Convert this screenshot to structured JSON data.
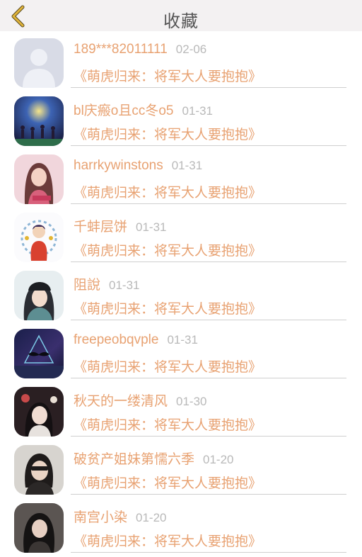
{
  "header": {
    "title": "收藏",
    "back_icon": "chevron-left-icon",
    "accent_color": "#e0b43a"
  },
  "colors": {
    "name": "#e8a272",
    "date": "#b9b9b9",
    "book": "#e8a272"
  },
  "favorites": [
    {
      "name": "189***82011111",
      "date": "02-06",
      "book": "《萌虎归来：将军大人要抱抱》",
      "avatar": "default-avatar-icon"
    },
    {
      "name": "bl庆瘢o且cc冬o5",
      "date": "01-31",
      "book": "《萌虎归来：将军大人要抱抱》",
      "avatar": "user-avatar"
    },
    {
      "name": "harrkywinstons",
      "date": "01-31",
      "book": "《萌虎归来：将军大人要抱抱》",
      "avatar": "user-avatar"
    },
    {
      "name": "千蚌层饼",
      "date": "01-31",
      "book": "《萌虎归来：将军大人要抱抱》",
      "avatar": "user-avatar"
    },
    {
      "name": "阻說",
      "date": "01-31",
      "book": "《萌虎归来：将军大人要抱抱》",
      "avatar": "user-avatar"
    },
    {
      "name": "freepeobqvple",
      "date": "01-31",
      "book": "《萌虎归来：将军大人要抱抱》",
      "avatar": "user-avatar"
    },
    {
      "name": "秋天的一缕清风",
      "date": "01-30",
      "book": "《萌虎归来：将军大人要抱抱》",
      "avatar": "user-avatar"
    },
    {
      "name": "破贫产姐妹第懦六季",
      "date": "01-20",
      "book": "《萌虎归来：将军大人要抱抱》",
      "avatar": "user-avatar"
    },
    {
      "name": "南宫小染",
      "date": "01-20",
      "book": "《萌虎归来：将军大人要抱抱》",
      "avatar": "user-avatar"
    }
  ]
}
